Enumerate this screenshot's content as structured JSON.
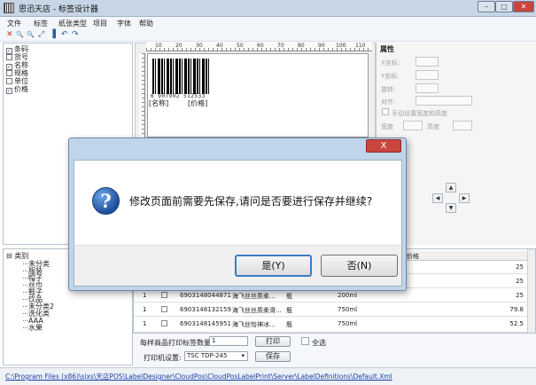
{
  "window": {
    "title": "思迅天店 - 标签设计器",
    "min": "–",
    "max": "□",
    "close": "✕"
  },
  "menu": [
    "文件",
    "标签",
    "纸张类型",
    "项目",
    "字体",
    "帮助"
  ],
  "toolbar_icons": [
    "✕",
    "🔍",
    "🔍",
    "⤢",
    "▐",
    "↶",
    "↷"
  ],
  "fields": [
    {
      "label": "条码",
      "checked": true
    },
    {
      "label": "货号",
      "checked": false
    },
    {
      "label": "名称",
      "checked": true
    },
    {
      "label": "规格",
      "checked": false
    },
    {
      "label": "单位",
      "checked": false
    },
    {
      "label": "价格",
      "checked": true
    }
  ],
  "ruler": [
    "10",
    "20",
    "30",
    "40",
    "50",
    "60",
    "70",
    "80",
    "90",
    "100",
    "110"
  ],
  "label_preview": {
    "barcode_number": "6 907992 512533",
    "name_tag": "[名称]",
    "price_tag": "[价格]"
  },
  "properties": {
    "title": "属性",
    "x_label": "X坐标:",
    "y_label": "Y坐标:",
    "rotate_label": "旋转:",
    "align_label": "对齐:",
    "manual_size_label": "手动设置宽度和高度",
    "width_label": "宽度",
    "height_label": "高度"
  },
  "nudge": {
    "up": "▲",
    "left": "◀",
    "right": "▶",
    "down": "▼"
  },
  "tree": {
    "root": "类别",
    "items": [
      "未分类",
      "服装",
      "帽子",
      "丝巾",
      "鞋子",
      "饮品",
      "未分类2",
      "洗化类",
      "AAA",
      "水果"
    ]
  },
  "table": {
    "col_label": "价格",
    "rows": [
      {
        "no": "1",
        "barcode": "",
        "name": "",
        "unit": "",
        "spec": "",
        "price": "25"
      },
      {
        "no": "1",
        "barcode": "",
        "name": "",
        "unit": "",
        "spec": "",
        "price": "25"
      },
      {
        "no": "1",
        "barcode": "6903148044871",
        "name": "海飞丝丝质柔...",
        "unit": "瓶",
        "spec": "200ml",
        "price": "25"
      },
      {
        "no": "1",
        "barcode": "6903148132159",
        "name": "海飞丝丝质柔滑...",
        "unit": "瓶",
        "spec": "750ml",
        "price": "79.8"
      },
      {
        "no": "1",
        "barcode": "6903148145951",
        "name": "海飞丝怡神冰...",
        "unit": "瓶",
        "spec": "750ml",
        "price": "52.5"
      }
    ]
  },
  "print": {
    "qty_label": "每样商品打印标签数量:",
    "qty_value": "1",
    "print_button": "打印",
    "select_all": "全选",
    "printer_label": "打印机设置:",
    "printer_value": "TSC TDP-245",
    "save_button": "保存"
  },
  "status": {
    "path": "C:\\Program Files (x86)\\sixs\\天店POS\\LabelDesigner\\CloudPos\\CloudPosLabelPrint\\Server\\LabelDefinitions\\Default.Xml"
  },
  "dialog": {
    "close": "X",
    "icon": "?",
    "message": "修改页面前需要先保存,请问是否要进行保存并继续?",
    "yes": "是(Y)",
    "no": "否(N)"
  }
}
